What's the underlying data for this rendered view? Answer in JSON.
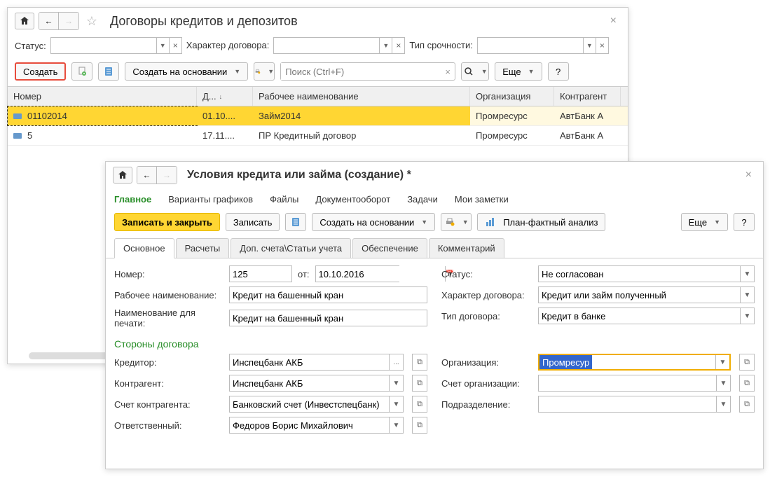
{
  "back": {
    "title": "Договоры кредитов и депозитов",
    "filters": {
      "status_label": "Статус:",
      "contract_type_label": "Характер договора:",
      "urgency_label": "Тип срочности:"
    },
    "toolbar": {
      "create": "Создать",
      "create_based_on": "Создать на основании",
      "search_placeholder": "Поиск (Ctrl+F)",
      "more": "Еще"
    },
    "columns": {
      "number": "Номер",
      "date": "Д...",
      "name": "Рабочее наименование",
      "org": "Организация",
      "counterparty": "Контрагент"
    },
    "rows": [
      {
        "number": "01102014",
        "date": "01.10....",
        "name": "Займ2014",
        "org": "Промресурс",
        "counterparty": "АвтБанк А"
      },
      {
        "number": "5",
        "date": "17.11....",
        "name": "ПР Кредитный договор",
        "org": "Промресурс",
        "counterparty": "АвтБанк А"
      }
    ]
  },
  "front": {
    "title": "Условия кредита или займа (создание) *",
    "nav": {
      "main": "Главное",
      "variants": "Варианты графиков",
      "files": "Файлы",
      "docflow": "Документооборот",
      "tasks": "Задачи",
      "notes": "Мои заметки"
    },
    "toolbar": {
      "save_close": "Записать и закрыть",
      "save": "Записать",
      "create_based_on": "Создать на основании",
      "plan_fact": "План-фактный анализ",
      "more": "Еще"
    },
    "tabs": {
      "main": "Основное",
      "calc": "Расчеты",
      "accounts": "Доп. счета\\Статьи учета",
      "collateral": "Обеспечение",
      "comment": "Комментарий"
    },
    "form": {
      "number_label": "Номер:",
      "number": "125",
      "from_label": "от:",
      "date": "10.10.2016",
      "status_label": "Статус:",
      "status": "Не согласован",
      "work_name_label": "Рабочее наименование:",
      "work_name": "Кредит на башенный кран",
      "contract_type_label": "Характер договора:",
      "contract_type": "Кредит или займ полученный",
      "print_name_label": "Наименование для печати:",
      "print_name": "Кредит на башенный кран",
      "deal_type_label": "Тип договора:",
      "deal_type": "Кредит в банке",
      "parties_header": "Стороны договора",
      "creditor_label": "Кредитор:",
      "creditor": "Инспецбанк АКБ",
      "org_label": "Организация:",
      "org": "Промресурс",
      "counterparty_label": "Контрагент:",
      "counterparty": "Инспецбанк АКБ",
      "org_account_label": "Счет организации:",
      "counterparty_account_label": "Счет контрагента:",
      "counterparty_account": "Банковский счет (Инвестспецбанк)",
      "division_label": "Подразделение:",
      "responsible_label": "Ответственный:",
      "responsible": "Федоров Борис Михайлович"
    }
  }
}
